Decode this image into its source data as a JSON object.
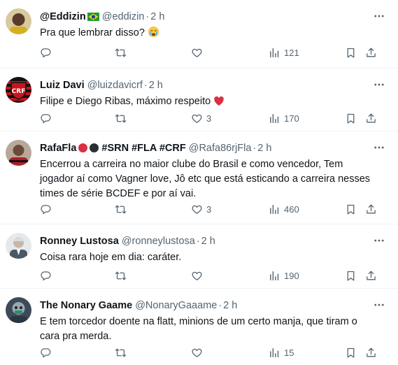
{
  "tweets": [
    {
      "name": "@Eddizin",
      "handle": "@eddizin",
      "dot": "·",
      "time": "2 h",
      "text": "Pra que lembrar disso?",
      "replies": "",
      "retweets": "",
      "likes": "",
      "views": "121",
      "avatar_color": "#c9a43a"
    },
    {
      "name": "Luiz Davi",
      "handle": "@luizdavicrf",
      "dot": "·",
      "time": "2 h",
      "text": "Filipe e Diego Ribas, máximo respeito",
      "replies": "",
      "retweets": "",
      "likes": "3",
      "views": "170",
      "avatar_color": "#c4161c"
    },
    {
      "name": "RafaFla",
      "tags": "#SRN #FLA #CRF",
      "handle": "@Rafa86rjFla",
      "dot": "·",
      "time": "2 h",
      "text": "Encerrou a carreira no maior clube do Brasil e como vencedor, Tem jogador aí como Vagner love, Jô etc que está esticando a carreira nesses times de série BCDEF e por aí vai.",
      "replies": "",
      "retweets": "",
      "likes": "3",
      "views": "460",
      "avatar_color": "#7a5a4a"
    },
    {
      "name": "Ronney Lustosa",
      "handle": "@ronneylustosa",
      "dot": "·",
      "time": "2 h",
      "text": "Coisa rara hoje em dia: caráter.",
      "replies": "",
      "retweets": "",
      "likes": "",
      "views": "190",
      "avatar_color": "#8a9aa8"
    },
    {
      "name": "The Nonary Gaame",
      "handle": "@NonaryGaaame",
      "dot": "·",
      "time": "2 h",
      "text": "E tem torcedor doente na flatt, minions de um certo manja, que tiram o cara pra merda.",
      "replies": "",
      "retweets": "",
      "likes": "",
      "views": "15",
      "avatar_color": "#6b7c8a"
    }
  ],
  "colors": {
    "text": "#0f1419",
    "secondary": "#536471",
    "divider": "#eff3f4",
    "heart": "#e0245e"
  },
  "icons": [
    "reply-icon",
    "retweet-icon",
    "like-icon",
    "views-icon",
    "bookmark-icon",
    "share-icon",
    "more-icon"
  ]
}
